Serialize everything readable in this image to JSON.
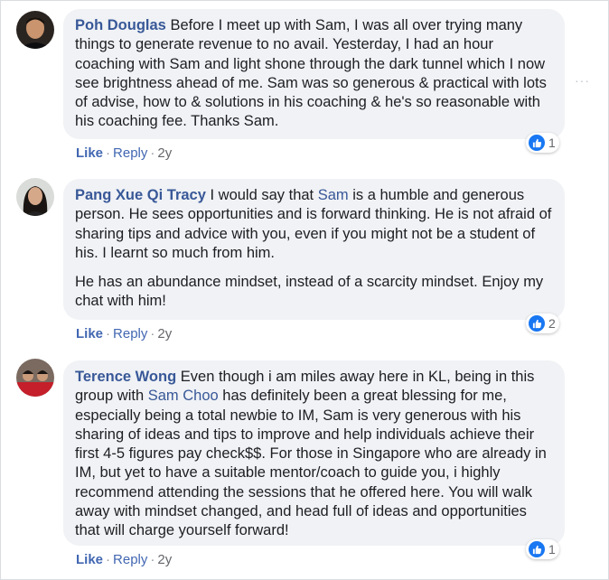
{
  "comments": [
    {
      "author": "Poh Douglas",
      "paragraphs": [
        [
          {
            "t": "Before I meet up with Sam, I was all over trying many things to generate revenue to no avail. Yesterday, I had an hour coaching with Sam and light shone through the dark tunnel which I now see brightness ahead of me. Sam was so generous & practical with lots of advise, how to & solutions in his coaching & he's so reasonable with his coaching fee. Thanks Sam."
          }
        ]
      ],
      "reaction_count": "1",
      "like_label": "Like",
      "reply_label": "Reply",
      "time": "2y"
    },
    {
      "author": "Pang Xue Qi Tracy",
      "paragraphs": [
        [
          {
            "t": "I would say that "
          },
          {
            "t": "Sam",
            "mention": true
          },
          {
            "t": " is a humble and generous person. He sees opportunities and is forward thinking. He is not afraid of sharing tips and advice with you, even if you might not be a student of his. I learnt so much from him."
          }
        ],
        [
          {
            "t": "He has an abundance mindset, instead of a scarcity mindset. Enjoy my chat with him!"
          }
        ]
      ],
      "reaction_count": "2",
      "like_label": "Like",
      "reply_label": "Reply",
      "time": "2y"
    },
    {
      "author": "Terence Wong",
      "paragraphs": [
        [
          {
            "t": "Even though i am miles away here in KL, being in this group with "
          },
          {
            "t": "Sam Choo",
            "mention": true
          },
          {
            "t": " has definitely been a great blessing for me, especially being a total newbie to IM, Sam is very generous with his sharing of ideas and tips to improve and help individuals achieve their first 4-5 figures pay check$$. For those in Singapore who are already in IM, but yet to have a suitable mentor/coach to guide you, i highly recommend attending the sessions that he offered here. You will walk away with mindset changed, and head full of ideas and opportunities that will charge yourself forward!"
          }
        ]
      ],
      "reaction_count": "1",
      "like_label": "Like",
      "reply_label": "Reply",
      "time": "2y"
    }
  ],
  "more_icon": "···",
  "colors": {
    "author": "#385898",
    "bubble": "#f0f2f5",
    "like_blue": "#1877f2",
    "meta": "#65676b"
  }
}
